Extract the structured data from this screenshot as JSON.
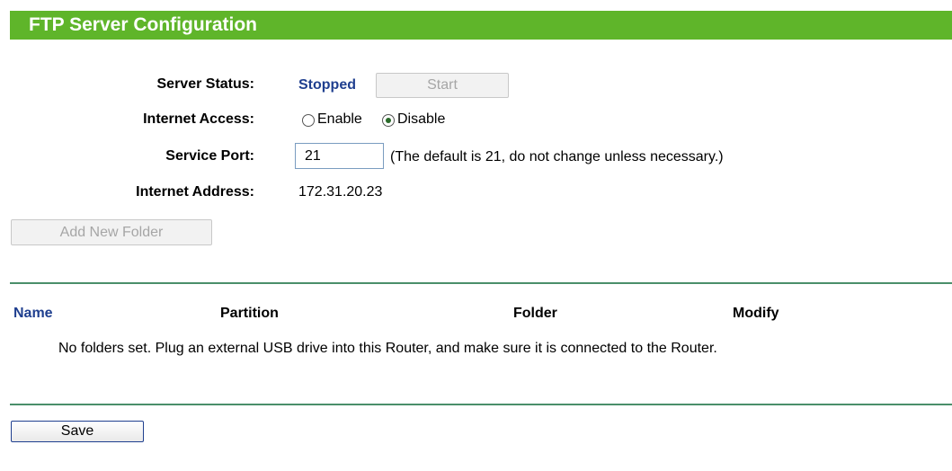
{
  "header": {
    "title": "FTP Server Configuration"
  },
  "form": {
    "server_status": {
      "label": "Server Status:",
      "value": "Stopped",
      "button": "Start"
    },
    "internet_access": {
      "label": "Internet Access:",
      "options": [
        "Enable",
        "Disable"
      ],
      "selected": "Disable"
    },
    "service_port": {
      "label": "Service Port:",
      "value": "21",
      "hint": "(The default is 21, do not change unless necessary.)"
    },
    "internet_address": {
      "label": "Internet Address:",
      "value": "172.31.20.23"
    }
  },
  "add_folder_button": "Add New Folder",
  "table": {
    "columns": [
      "Name",
      "Partition",
      "Folder",
      "Modify"
    ],
    "empty_message": "No folders set. Plug an external USB drive into this Router, and make sure it is connected to the Router."
  },
  "save_button": "Save",
  "colors": {
    "header_bg": "#5fb52a",
    "status_text": "#1f3f8f",
    "rule": "#4a8f6a"
  }
}
